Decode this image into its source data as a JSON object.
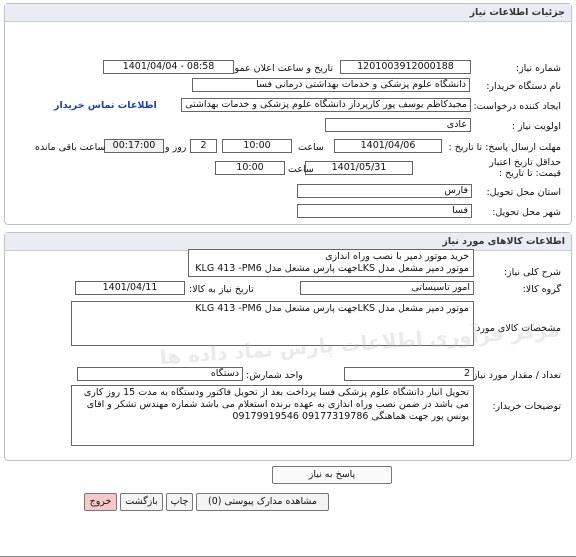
{
  "header": {
    "title": "جزئیات اطلاعات نیاز"
  },
  "need_info": {
    "need_number_label": "شماره نیاز:",
    "need_number": "1201003912000188",
    "announce_label": "تاریخ و ساعت اعلان عمومی:",
    "announce_value": "1401/04/04 - 08:58",
    "buyer_label": "نام دستگاه خریدار:",
    "buyer_value": "دانشگاه علوم پزشکی و خدمات بهداشتی درمانی فسا",
    "creator_label": "ایجاد کننده درخواست:",
    "creator_value": "مجیدکاظم یوسف پور کارپرداز دانشگاه علوم پزشکی و خدمات بهداشتی درمانی فسا",
    "contact_link": "اطلاعات تماس خریدار",
    "priority_label": "اولویت نیاز :",
    "priority_value": "عادی",
    "deadline_label": "مهلت ارسال پاسخ: تا تاریخ :",
    "deadline_date": "1401/04/06",
    "time_label": "ساعت",
    "deadline_time": "10:00",
    "days_value": "2",
    "days_label": "روز و",
    "remaining_time": "00:17:00",
    "remaining_label": "ساعت باقی مانده",
    "validity_label_1": "حداقل تاریخ اعتبار",
    "validity_label_2": "قیمت: تا تاریخ :",
    "validity_date": "1401/05/31",
    "validity_time_label": "ساعت",
    "validity_time": "10:00",
    "province_label": "استان محل تحویل:",
    "province_value": "فارس",
    "city_label": "شهر محل تحویل:",
    "city_value": "فسا"
  },
  "goods": {
    "section_title": "اطلاعات کالاهای مورد نیاز",
    "summary_label": "شرح کلی نیاز:",
    "summary_line1": "خرید موتور دمپر با نصب وراه اندازی",
    "summary_line2": "موتور دمپر مشعل مدل LKSجهت پارس مشعل مدل KLG  413  -PM6",
    "group_label": "گروه کالا:",
    "group_value": "امور تاسیساتی",
    "need_date_label": "تاریخ نیاز به کالا:",
    "need_date_value": "1401/04/11",
    "spec_label": "مشخصات کالای مورد نیاز:",
    "spec_value": "موتور دمپر مشعل مدل LKSجهت پارس مشعل مدل KLG  413  -PM6",
    "qty_label": "تعداد / مقدار مورد نیاز:",
    "qty_value": "2",
    "unit_label": "واحد شمارش:",
    "unit_value": "دستگاه",
    "notes_label": "توضیحات خریدار:",
    "notes_value": "تحویل انبار دانشگاه علوم پزشکی فسا پرداخت بعد از تحویل فاکتور ودستگاه به مدت 15 روز کاری می باشد در ضمن نصب وراه اندازی به عهده برنده استعلام می باشد شماره مهندس تشکر و اقای یونس پور جهت هماهنگی 09177319786 09179919546"
  },
  "buttons": {
    "reply": "پاسخ به نیاز",
    "attachments": "مشاهده مدارک پیوستی (0)",
    "print": "چاپ",
    "back": "بازگشت",
    "exit": "خروج"
  },
  "watermark": {
    "line1": "مرکز فرآوری اطلاعات پارس نماد داده ها",
    "line2": ""
  },
  "colors": {
    "exit_bg": "#f6c9c9",
    "link": "#1a3fb0",
    "header_bg": "#e9edf2"
  }
}
